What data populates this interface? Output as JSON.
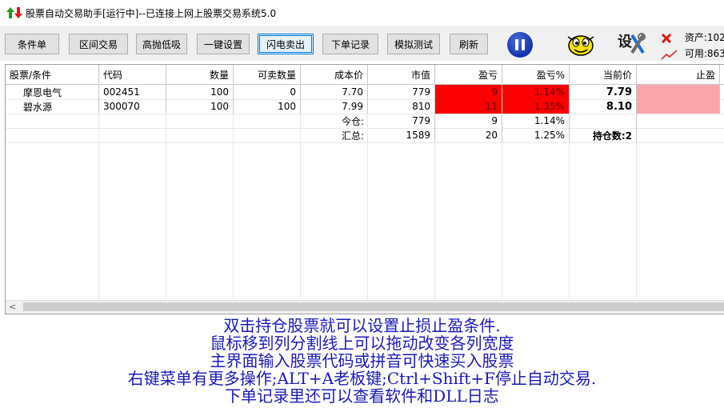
{
  "window": {
    "title": "股票自动交易助手[运行中]--已连接上网上股票交易系统5.0"
  },
  "toolbar": {
    "buttons": [
      "条件单",
      "区间交易",
      "高抛低吸",
      "一键设置",
      "闪电卖出",
      "下单记录",
      "模拟测试",
      "刷新"
    ],
    "active_button": "闪电卖出"
  },
  "account": {
    "assets_text": "资产:102",
    "available_text": "可用:863"
  },
  "table": {
    "columns": [
      "股票/条件",
      "代码",
      "数量",
      "可卖数量",
      "成本价",
      "市值",
      "盈亏",
      "盈亏%",
      "当前价",
      "止盈"
    ],
    "rows": [
      {
        "name": "摩恩电气",
        "code": "002451",
        "qty": "100",
        "sellable": "0",
        "cost": "7.70",
        "value": "779",
        "pnl": "9",
        "pnl_pct": "1.14%",
        "price": "7.79",
        "take_profit": ""
      },
      {
        "name": "碧水源",
        "code": "300070",
        "qty": "100",
        "sellable": "100",
        "cost": "7.99",
        "value": "810",
        "pnl": "11",
        "pnl_pct": "1.35%",
        "price": "8.10",
        "take_profit": ""
      }
    ],
    "summary": [
      {
        "label": "今仓:",
        "value": "779",
        "pnl": "9",
        "pnl_pct": "1.14%",
        "extra": ""
      },
      {
        "label": "汇总:",
        "value": "1589",
        "pnl": "20",
        "pnl_pct": "1.25%",
        "extra": "持仓数:2"
      }
    ],
    "colors": {
      "loss_gain_cell": "#fa0000",
      "take_profit_cell": "#f9a5ab"
    }
  },
  "tips": [
    "双击持仓股票就可以设置止损止盈条件.",
    "鼠标移到列分割线上可以拖动改变各列宽度",
    "主界面输入股票代码或拼音可快速买入股票",
    "右键菜单有更多操作;ALT+A老板键;Ctrl+Shift+F停止自动交易.",
    "下单记录里还可以查看软件和DLL日志"
  ],
  "tip_color": "#1a1ab8"
}
